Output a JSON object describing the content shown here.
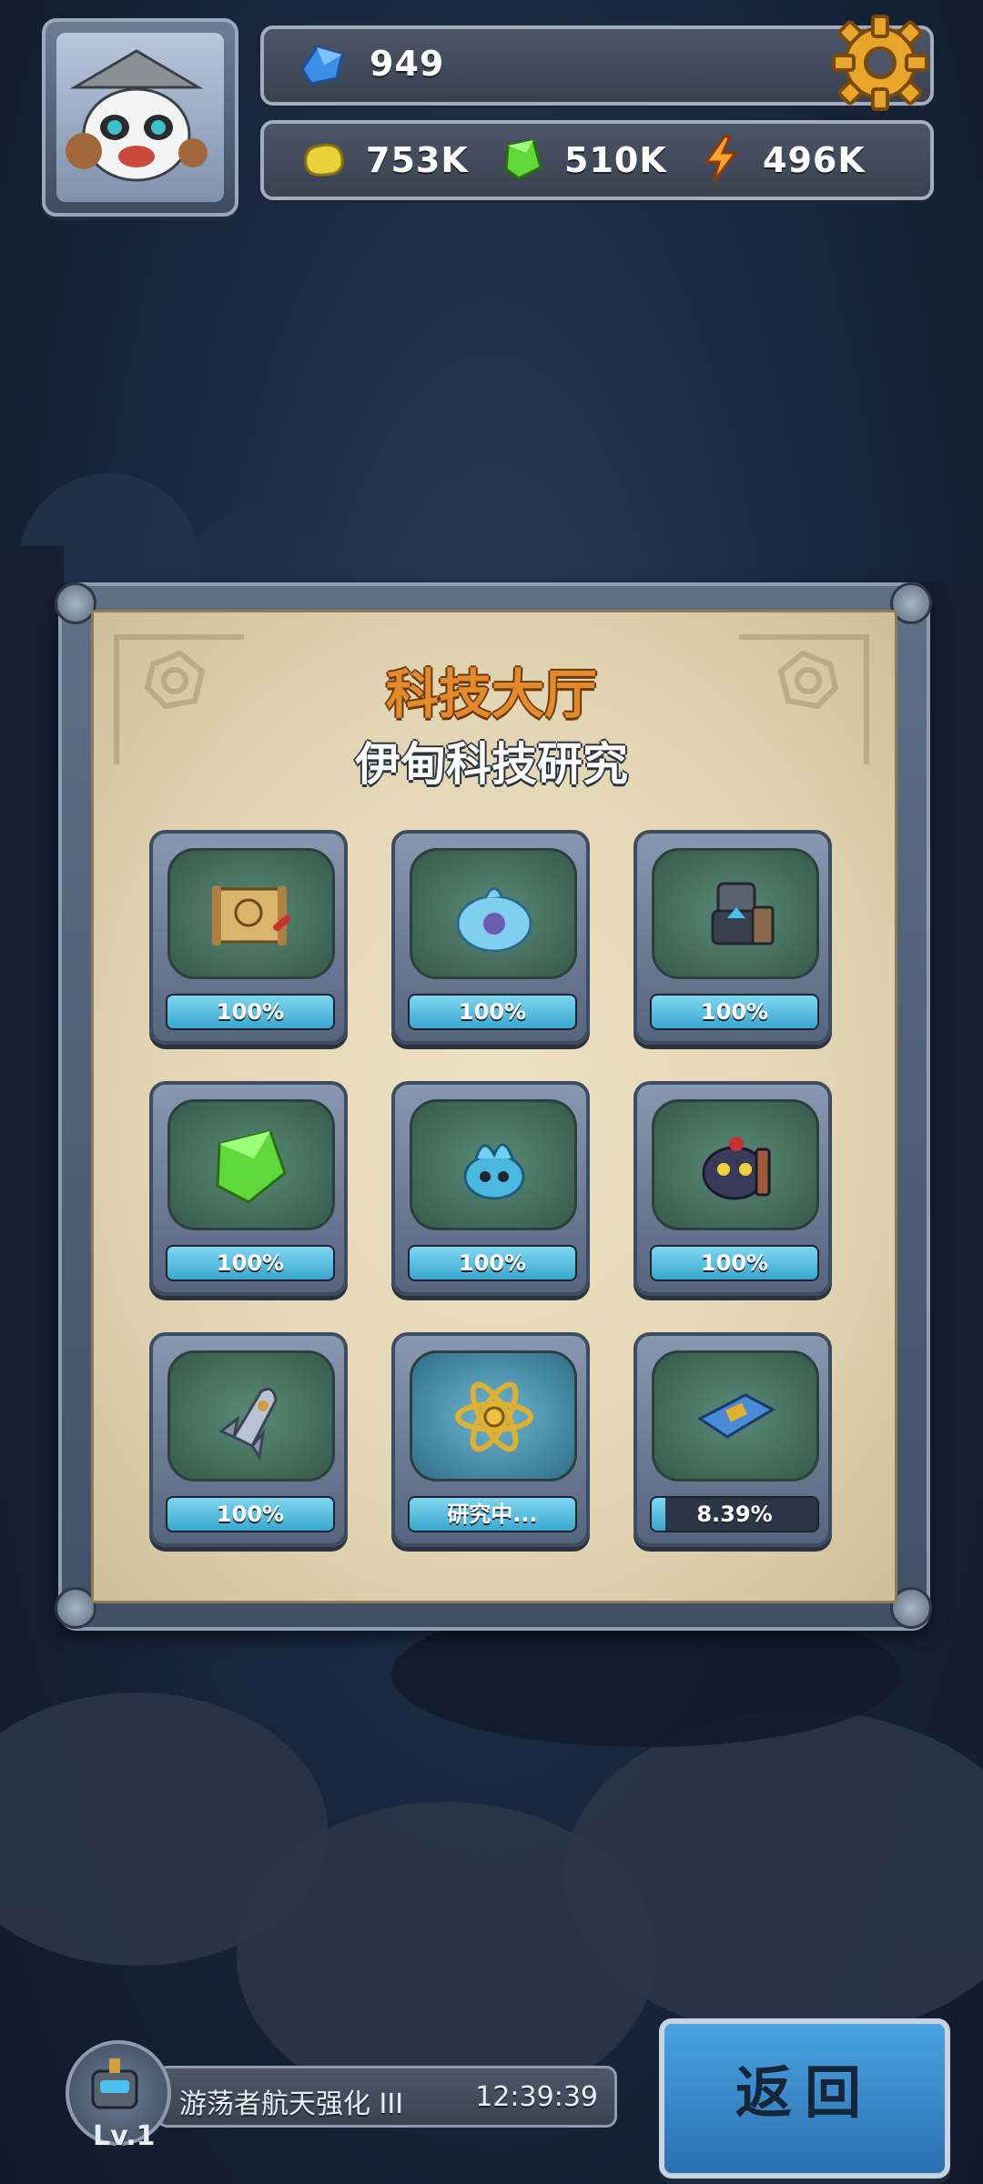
{
  "hud": {
    "gems": "949",
    "gold": "753K",
    "green_crystal": "510K",
    "energy": "496K"
  },
  "panel": {
    "title": "科技大厅",
    "subtitle": "伊甸科技研究",
    "tiles": [
      {
        "icon": "map-scroll-icon",
        "progress": 1.0,
        "label": "100%"
      },
      {
        "icon": "blue-slime-icon",
        "progress": 1.0,
        "label": "100%"
      },
      {
        "icon": "robot-armor-icon",
        "progress": 1.0,
        "label": "100%"
      },
      {
        "icon": "green-crystal-icon",
        "progress": 1.0,
        "label": "100%"
      },
      {
        "icon": "blue-creature-icon",
        "progress": 1.0,
        "label": "100%"
      },
      {
        "icon": "dark-beast-icon",
        "progress": 1.0,
        "label": "100%"
      },
      {
        "icon": "spaceship-icon",
        "progress": 1.0,
        "label": "100%"
      },
      {
        "icon": "atom-icon",
        "progress": 1.0,
        "label": "研究中..."
      },
      {
        "icon": "chip-card-icon",
        "progress": 0.0839,
        "label": "8.39%"
      }
    ]
  },
  "bottom": {
    "level": "Lv.1",
    "task_name": "游荡者航天强化 III",
    "task_timer": "12:39:39",
    "return_label": "返回"
  },
  "colors": {
    "title": "#e58a2a",
    "progress_fill": "#3aa8cf",
    "return_button": "#2a6fb0"
  }
}
